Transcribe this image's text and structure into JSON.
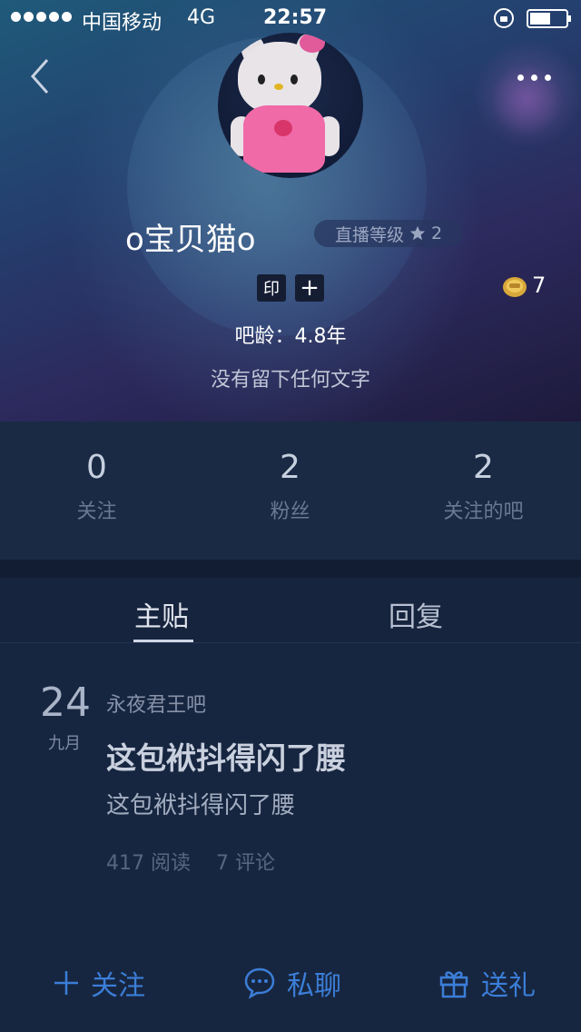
{
  "status_bar": {
    "carrier": "中国移动",
    "network": "4G",
    "time": "22:57"
  },
  "profile": {
    "username": "o宝贝猫o",
    "live_level_label": "直播等级",
    "live_level_value": "2",
    "badge_yin": "印",
    "badge_plus": "+",
    "coin_count": "7",
    "age": "吧龄：4.8年",
    "bio": "没有留下任何文字"
  },
  "stats": [
    {
      "value": "0",
      "label": "关注"
    },
    {
      "value": "2",
      "label": "粉丝"
    },
    {
      "value": "2",
      "label": "关注的吧"
    }
  ],
  "tabs": {
    "main": "主贴",
    "reply": "回复"
  },
  "post": {
    "day": "24",
    "month": "九月",
    "forum": "永夜君王吧",
    "title": "这包袱抖得闪了腰",
    "excerpt": "这包袱抖得闪了腰",
    "reads": "417 阅读",
    "comments": "7 评论"
  },
  "actions": {
    "follow": "关注",
    "chat": "私聊",
    "gift": "送礼"
  },
  "colors": {
    "accent": "#3b7ed8",
    "background": "#172640"
  }
}
